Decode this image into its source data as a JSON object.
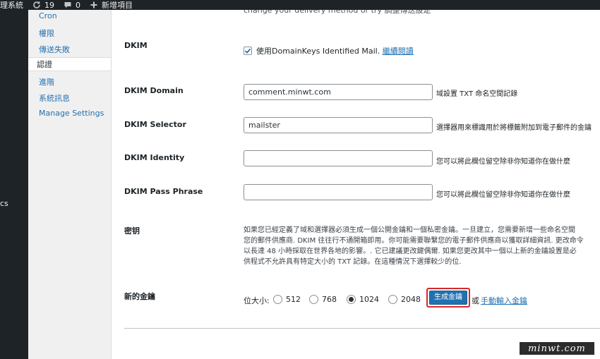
{
  "adminbar": {
    "site_fragment": "理系統",
    "updates_count": "19",
    "comments_count": "0",
    "new_label": "新增項目"
  },
  "adminmenu": {
    "fragment": "cs"
  },
  "subnav": {
    "items": [
      {
        "label": "Cron"
      },
      {
        "label": "權限"
      },
      {
        "label": "傳送失敗"
      },
      {
        "label": "認證"
      },
      {
        "label": "進階"
      },
      {
        "label": "系統訊息"
      },
      {
        "label": "Manage Settings"
      }
    ]
  },
  "content": {
    "top_cut_text": "change your delivery method or try 調整傳送設定",
    "dkim": {
      "label": "DKIM",
      "checkbox_label": "使用DomainKeys Identified Mail. ",
      "read_more": "繼續閱讀",
      "checked": true
    },
    "dkim_domain": {
      "label": "DKIM Domain",
      "value": "comment.minwt.com",
      "desc": "域設置 TXT 命名空間記錄"
    },
    "dkim_selector": {
      "label": "DKIM Selector",
      "value": "mailster",
      "desc": "選擇器用來標識用於將標籤附加到電子郵件的金鑰"
    },
    "dkim_identity": {
      "label": "DKIM Identity",
      "value": "",
      "desc": "您可以將此欄位留空除非你知道你在做什麼"
    },
    "dkim_pass": {
      "label": "DKIM Pass Phrase",
      "value": "",
      "desc": "您可以將此欄位留空除非你知道你在做什麼"
    },
    "keys": {
      "label": "密钥",
      "lines": [
        "如果您已經定義了域和選擇器必須生成一個公開金鑰和一個私密金鑰。一旦建立，您需要新增一些命名空間",
        "您的郵件供應商. DKIM 往往行不通開箱即用。你可能需要聯繫您的電子郵件供應商以獲取詳細資訊. 更改命令",
        "以長達 48 小時採取在世界各地的影響。. 它已建議更改鍵偶爾. 如果您更改其中一個以上新的金鑰設置是必",
        "供程式不允許具有特定大小的 TXT 記錄。在這種情況下選擇較少的位."
      ]
    },
    "new_key": {
      "label": "新的金鑰",
      "bitsize_label": "位大小:",
      "options": [
        "512",
        "768",
        "1024",
        "2048"
      ],
      "selected": "1024",
      "generate_label": "生成金鑰",
      "or_text": "或",
      "manual_link": "手動輸入金鑰"
    }
  },
  "watermark": "minwt.com",
  "colors": {
    "link": "#2271b1",
    "button": "#2271b1",
    "highlight_border": "#d42a2a",
    "adminbar": "#1d2327"
  }
}
